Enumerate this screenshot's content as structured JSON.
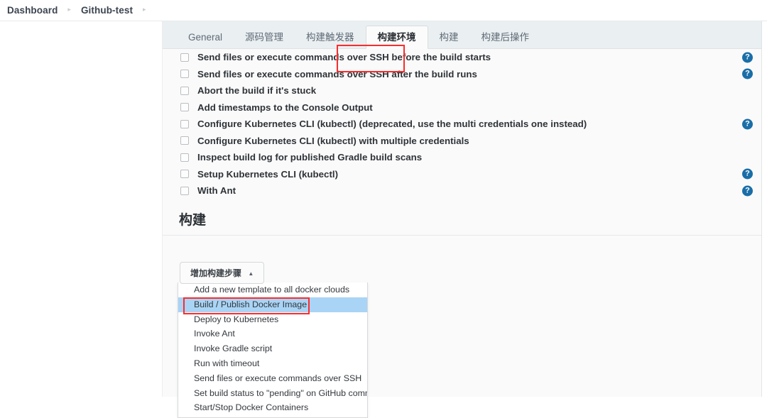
{
  "breadcrumb": {
    "items": [
      {
        "label": "Dashboard"
      },
      {
        "label": "Github-test"
      }
    ],
    "separator": "▸"
  },
  "tabs": [
    {
      "label": "General",
      "active": false
    },
    {
      "label": "源码管理",
      "active": false
    },
    {
      "label": "构建触发器",
      "active": false
    },
    {
      "label": "构建环境",
      "active": true
    },
    {
      "label": "构建",
      "active": false
    },
    {
      "label": "构建后操作",
      "active": false
    }
  ],
  "build_environment": {
    "options": [
      {
        "label": "Send files or execute commands over SSH before the build starts",
        "checked": false,
        "help": true
      },
      {
        "label": "Send files or execute commands over SSH after the build runs",
        "checked": false,
        "help": true
      },
      {
        "label": "Abort the build if it's stuck",
        "checked": false,
        "help": false
      },
      {
        "label": "Add timestamps to the Console Output",
        "checked": false,
        "help": false
      },
      {
        "label": "Configure Kubernetes CLI (kubectl) (deprecated, use the multi credentials one instead)",
        "checked": false,
        "help": true
      },
      {
        "label": "Configure Kubernetes CLI (kubectl) with multiple credentials",
        "checked": false,
        "help": false
      },
      {
        "label": "Inspect build log for published Gradle build scans",
        "checked": false,
        "help": false
      },
      {
        "label": "Setup Kubernetes CLI (kubectl)",
        "checked": false,
        "help": true
      },
      {
        "label": "With Ant",
        "checked": false,
        "help": true
      }
    ]
  },
  "build_section": {
    "heading": "构建",
    "add_step_button": {
      "label": "增加构建步骤",
      "caret": "▲"
    },
    "dropdown_items": [
      {
        "label": "Add a new template to all docker clouds",
        "selected": false
      },
      {
        "label": "Build / Publish Docker Image",
        "selected": true
      },
      {
        "label": "Deploy to Kubernetes",
        "selected": false
      },
      {
        "label": "Invoke Ant",
        "selected": false
      },
      {
        "label": "Invoke Gradle script",
        "selected": false
      },
      {
        "label": "Run with timeout",
        "selected": false
      },
      {
        "label": "Send files or execute commands over SSH",
        "selected": false
      },
      {
        "label": "Set build status to \"pending\" on GitHub commit",
        "selected": false
      },
      {
        "label": "Start/Stop Docker Containers",
        "selected": false
      }
    ]
  },
  "icons": {
    "help": "?"
  },
  "colors": {
    "annotation": "#fb2c2c",
    "help_icon": "#1a6ea8",
    "menu_selected": "#a9d4f5",
    "tab_bar": "#eaeff2"
  }
}
